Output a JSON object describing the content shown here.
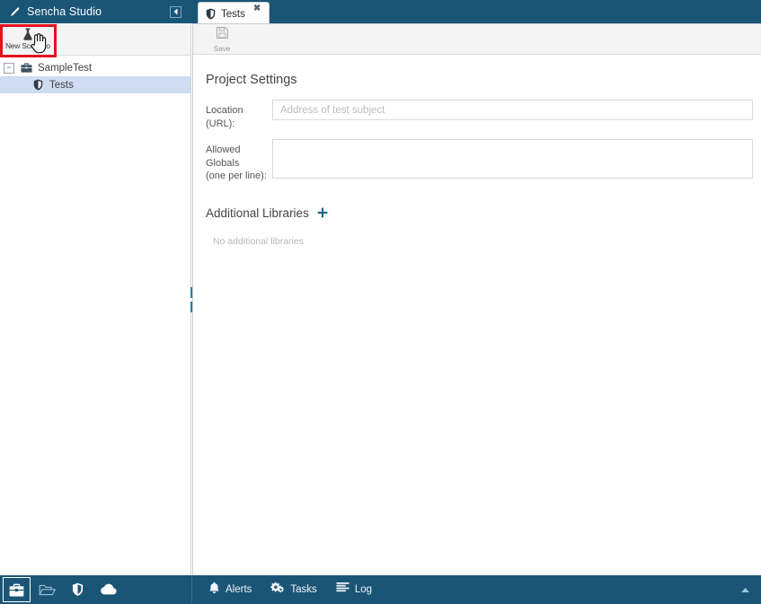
{
  "header": {
    "title": "Sencha Studio",
    "logo_icon": "pen-nib-icon",
    "collapse_icon": "collapse-left-icon",
    "help_icon": "help-icon",
    "help_glyph": "?",
    "settings_icon": "gear-icon"
  },
  "sidebar": {
    "toolbar": {
      "new_scenario_label": "New Scenario",
      "new_scenario_icon": "flask-icon"
    },
    "tree": [
      {
        "label": "SampleTest",
        "icon": "briefcase-icon",
        "toggle": "−",
        "level": 0,
        "selected": false
      },
      {
        "label": "Tests",
        "icon": "shield-icon",
        "level": 1,
        "selected": true
      }
    ]
  },
  "main": {
    "tabs": [
      {
        "label": "Tests",
        "icon": "shield-icon",
        "close_glyph": "✖",
        "active": true
      }
    ],
    "toolbar": {
      "save_label": "Save",
      "save_icon": "floppy-disk-icon"
    },
    "project_settings": {
      "title": "Project Settings",
      "location_label": "Location (URL):",
      "location_value": "",
      "location_placeholder": "Address of test subject",
      "globals_label_line1": "Allowed Globals",
      "globals_label_line2": "(one per line):",
      "globals_value": "",
      "globals_placeholder": ""
    },
    "additional_libraries": {
      "title": "Additional Libraries",
      "add_icon": "plus-icon",
      "add_glyph": "✚",
      "empty_text": "No additional libraries"
    }
  },
  "bottombar": {
    "left_icons": [
      {
        "name": "briefcase-icon",
        "active": true
      },
      {
        "name": "folder-open-icon",
        "active": false
      },
      {
        "name": "shield-icon",
        "active": false
      },
      {
        "name": "cloud-icon",
        "active": false
      }
    ],
    "items": [
      {
        "label": "Alerts",
        "icon": "bell-icon"
      },
      {
        "label": "Tasks",
        "icon": "gears-icon"
      },
      {
        "label": "Log",
        "icon": "log-lines-icon"
      }
    ],
    "caret_icon": "chevron-up-icon"
  },
  "annotation": {
    "highlight_color": "#e4121d",
    "target": "new-scenario-button"
  },
  "colors": {
    "chrome_blue": "#1a5576",
    "selection_blue": "#cfdcf1",
    "accent_teal": "#1b6b8e",
    "toolbar_gray": "#f4f4f4"
  }
}
